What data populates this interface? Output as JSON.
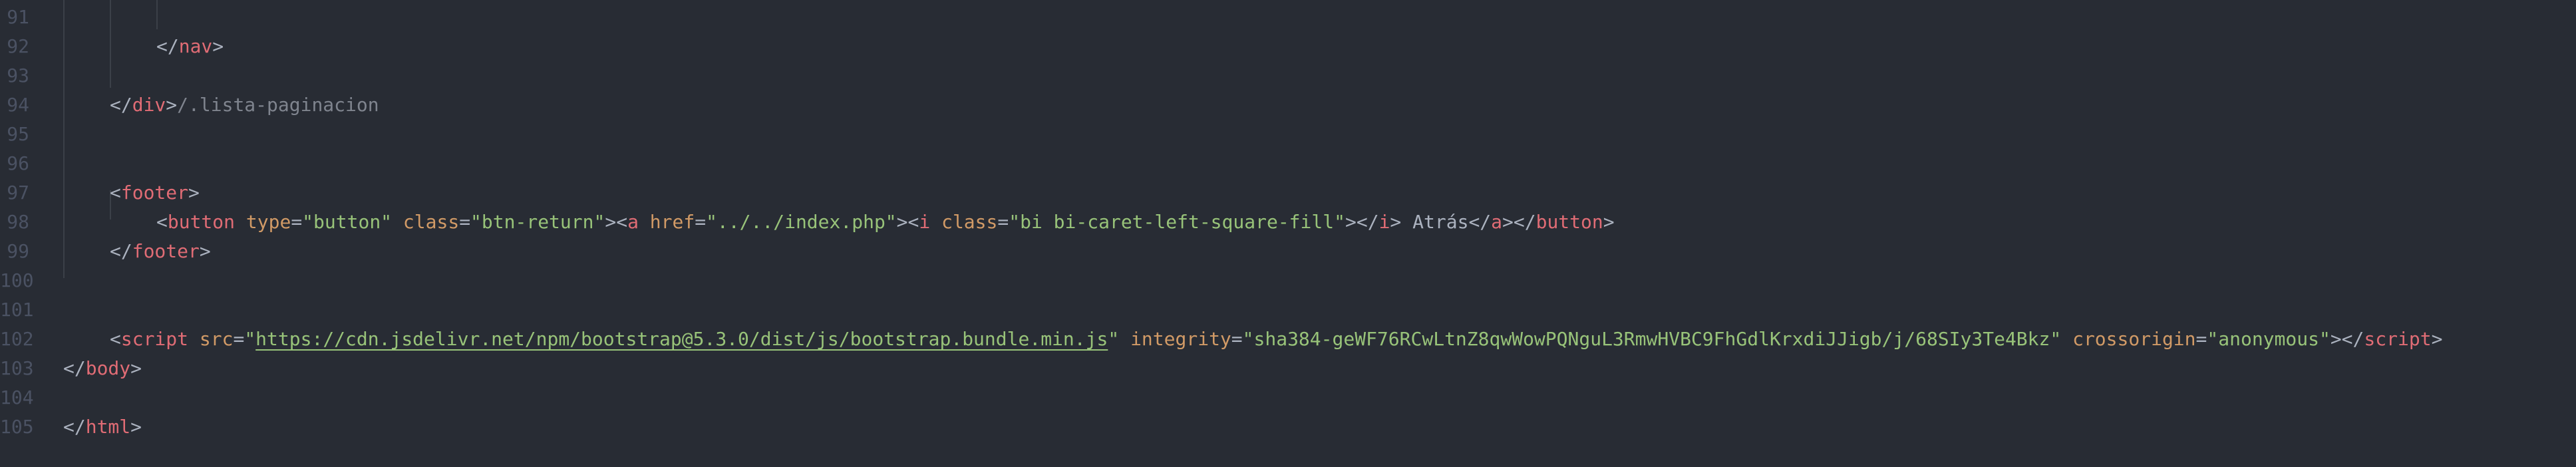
{
  "editor": {
    "lines": [
      {
        "number": "91",
        "tokens": []
      },
      {
        "number": "92",
        "tokens": [
          {
            "t": "punct",
            "v": "</"
          },
          {
            "t": "tag",
            "v": "nav"
          },
          {
            "t": "punct",
            "v": ">"
          }
        ]
      },
      {
        "number": "93",
        "tokens": []
      },
      {
        "number": "94",
        "tokens": [
          {
            "t": "punct",
            "v": "</"
          },
          {
            "t": "tag",
            "v": "div"
          },
          {
            "t": "punct",
            "v": ">"
          },
          {
            "t": "cmt",
            "v": "/.lista-paginacion"
          }
        ]
      },
      {
        "number": "95",
        "tokens": []
      },
      {
        "number": "96",
        "tokens": []
      },
      {
        "number": "97",
        "tokens": [
          {
            "t": "punct",
            "v": "<"
          },
          {
            "t": "tag",
            "v": "footer"
          },
          {
            "t": "punct",
            "v": ">"
          }
        ]
      },
      {
        "number": "98",
        "tokens": [
          {
            "t": "punct",
            "v": "<"
          },
          {
            "t": "tag",
            "v": "button"
          },
          {
            "t": "txt",
            "v": " "
          },
          {
            "t": "attr",
            "v": "type"
          },
          {
            "t": "punct",
            "v": "="
          },
          {
            "t": "str",
            "v": "\"button\""
          },
          {
            "t": "txt",
            "v": " "
          },
          {
            "t": "attr",
            "v": "class"
          },
          {
            "t": "punct",
            "v": "="
          },
          {
            "t": "str",
            "v": "\"btn-return\""
          },
          {
            "t": "punct",
            "v": "><"
          },
          {
            "t": "tag",
            "v": "a"
          },
          {
            "t": "txt",
            "v": " "
          },
          {
            "t": "attr",
            "v": "href"
          },
          {
            "t": "punct",
            "v": "="
          },
          {
            "t": "str",
            "v": "\"../../index.php\""
          },
          {
            "t": "punct",
            "v": "><"
          },
          {
            "t": "tag",
            "v": "i"
          },
          {
            "t": "txt",
            "v": " "
          },
          {
            "t": "attr",
            "v": "class"
          },
          {
            "t": "punct",
            "v": "="
          },
          {
            "t": "str",
            "v": "\"bi bi-caret-left-square-fill\""
          },
          {
            "t": "punct",
            "v": "></"
          },
          {
            "t": "tag",
            "v": "i"
          },
          {
            "t": "punct",
            "v": ">"
          },
          {
            "t": "txt",
            "v": " Atrás"
          },
          {
            "t": "punct",
            "v": "</"
          },
          {
            "t": "tag",
            "v": "a"
          },
          {
            "t": "punct",
            "v": "></"
          },
          {
            "t": "tag",
            "v": "button"
          },
          {
            "t": "punct",
            "v": ">"
          }
        ]
      },
      {
        "number": "99",
        "tokens": [
          {
            "t": "punct",
            "v": "</"
          },
          {
            "t": "tag",
            "v": "footer"
          },
          {
            "t": "punct",
            "v": ">"
          }
        ]
      },
      {
        "number": "100",
        "tokens": []
      },
      {
        "number": "101",
        "tokens": []
      },
      {
        "number": "102",
        "tokens": [
          {
            "t": "punct",
            "v": "<"
          },
          {
            "t": "tag",
            "v": "script"
          },
          {
            "t": "txt",
            "v": " "
          },
          {
            "t": "attr",
            "v": "src"
          },
          {
            "t": "punct",
            "v": "="
          },
          {
            "t": "str",
            "v": "\""
          },
          {
            "t": "url",
            "v": "https://cdn.jsdelivr.net/npm/bootstrap@5.3.0/dist/js/bootstrap.bundle.min.js"
          },
          {
            "t": "str",
            "v": "\""
          },
          {
            "t": "txt",
            "v": " "
          },
          {
            "t": "attr",
            "v": "integrity"
          },
          {
            "t": "punct",
            "v": "="
          },
          {
            "t": "str",
            "v": "\"sha384-geWF76RCwLtnZ8qwWowPQNguL3RmwHVBC9FhGdlKrxdiJJigb/j/68SIy3Te4Bkz\""
          },
          {
            "t": "txt",
            "v": " "
          },
          {
            "t": "attr",
            "v": "crossorigin"
          },
          {
            "t": "punct",
            "v": "="
          },
          {
            "t": "str",
            "v": "\"anonymous\""
          },
          {
            "t": "punct",
            "v": "></"
          },
          {
            "t": "tag",
            "v": "script"
          },
          {
            "t": "punct",
            "v": ">"
          }
        ]
      },
      {
        "number": "103",
        "tokens": [
          {
            "t": "punct",
            "v": "</"
          },
          {
            "t": "tag",
            "v": "body"
          },
          {
            "t": "punct",
            "v": ">"
          }
        ]
      },
      {
        "number": "104",
        "tokens": []
      },
      {
        "number": "105",
        "tokens": [
          {
            "t": "punct",
            "v": "</"
          },
          {
            "t": "tag",
            "v": "html"
          },
          {
            "t": "punct",
            "v": ">"
          }
        ]
      }
    ]
  },
  "colors": {
    "background": "#282c34",
    "line_number": "#4b5263",
    "tag": "#e06c75",
    "attribute": "#d19a66",
    "string": "#98c379",
    "punctuation": "#abb2bf",
    "comment": "#7f848e"
  }
}
